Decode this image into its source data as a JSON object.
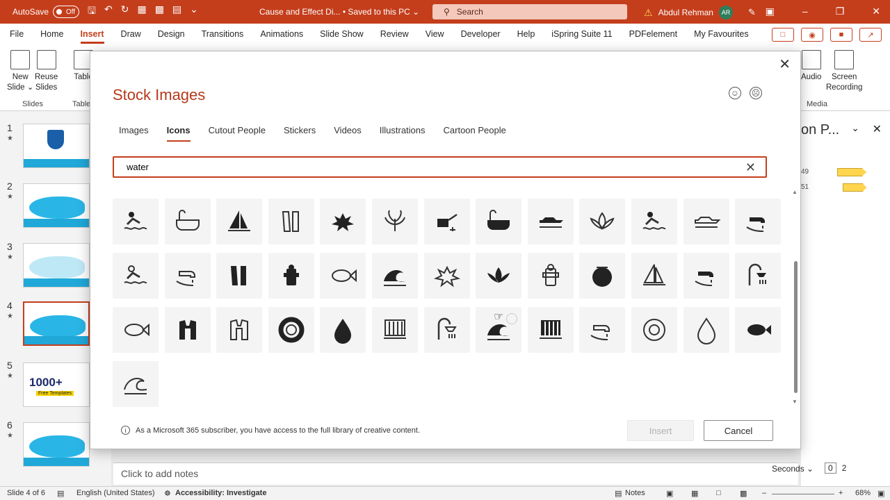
{
  "titlebar": {
    "autosave_label": "AutoSave",
    "autosave_state": "Off",
    "doc_title": "Cause and Effect Di...",
    "doc_status": "• Saved to this PC ⌄",
    "search_placeholder": "Search",
    "user_name": "Abdul Rehman",
    "user_initials": "AR",
    "accent": "#c43e1c"
  },
  "ribbon_tabs": [
    "File",
    "Home",
    "Insert",
    "Draw",
    "Design",
    "Transitions",
    "Animations",
    "Slide Show",
    "Review",
    "View",
    "Developer",
    "Help",
    "iSpring Suite 11",
    "PDFelement",
    "My Favourites"
  ],
  "ribbon": {
    "new_slide": "New\nSlide ⌄",
    "reuse_slides": "Reuse\nSlides",
    "table": "Table",
    "slides_group": "Slides",
    "table_group": "Table",
    "audio": "Audio",
    "screen_recording": "Screen\nRecording",
    "media_group": "Media"
  },
  "slides": {
    "numbers": [
      "1",
      "2",
      "3",
      "4",
      "5",
      "6"
    ],
    "star": "★",
    "thumb5_text": "1000+",
    "thumb5_sub": "Free Templates"
  },
  "panel": {
    "title": "on P...",
    "label1": "49",
    "label2": "51"
  },
  "notes_placeholder": "Click to add notes",
  "timing": {
    "seconds": "Seconds ⌄",
    "page_current": "0",
    "page_total": "2"
  },
  "statusbar": {
    "slide_info": "Slide 4 of 6",
    "language": "English (United States)",
    "accessibility": "Accessibility: Investigate",
    "notes": "Notes",
    "zoom": "68%"
  },
  "dialog": {
    "title": "Stock Images",
    "tabs": [
      "Images",
      "Icons",
      "Cutout People",
      "Stickers",
      "Videos",
      "Illustrations",
      "Cartoon People"
    ],
    "active_tab": "Icons",
    "search_value": "water",
    "footnote": "As a Microsoft 365 subscriber, you have access to the full library of creative content.",
    "insert_label": "Insert",
    "cancel_label": "Cancel",
    "icons": [
      "swimmer-relaxing-icon",
      "bathtub-outline-icon",
      "sailboat-icon",
      "swim-fins-outline-icon",
      "splash-icon",
      "water-plant-icon",
      "watering-can-icon",
      "bathtub-icon",
      "jet-ski-icon",
      "lotus-outline-icon",
      "water-slide-icon",
      "boat-outline-icon",
      "faucet-icon",
      "swimmer-outline-icon",
      "sink-outline-icon",
      "swim-fins-icon",
      "fire-hydrant-icon",
      "fish-outline-icon",
      "swimmer-waves-icon",
      "splash-outline-icon",
      "lotus-icon",
      "fire-hydrant-outline-icon",
      "fishbowl-icon",
      "sailboat-outline-icon",
      "hand-faucet-icon",
      "shower-icon",
      "clownfish-outline-icon",
      "life-jacket-icon",
      "life-jacket-outline-icon",
      "lifebuoy-icon",
      "water-drop-icon",
      "waterfall-outline-icon",
      "shower-outline-icon",
      "wave-rock-icon",
      "waterfall-icon",
      "hand-water-outline-icon",
      "lifebuoy-outline-icon",
      "water-drop-outline-icon",
      "clownfish-icon",
      "wave-outline-icon"
    ]
  }
}
